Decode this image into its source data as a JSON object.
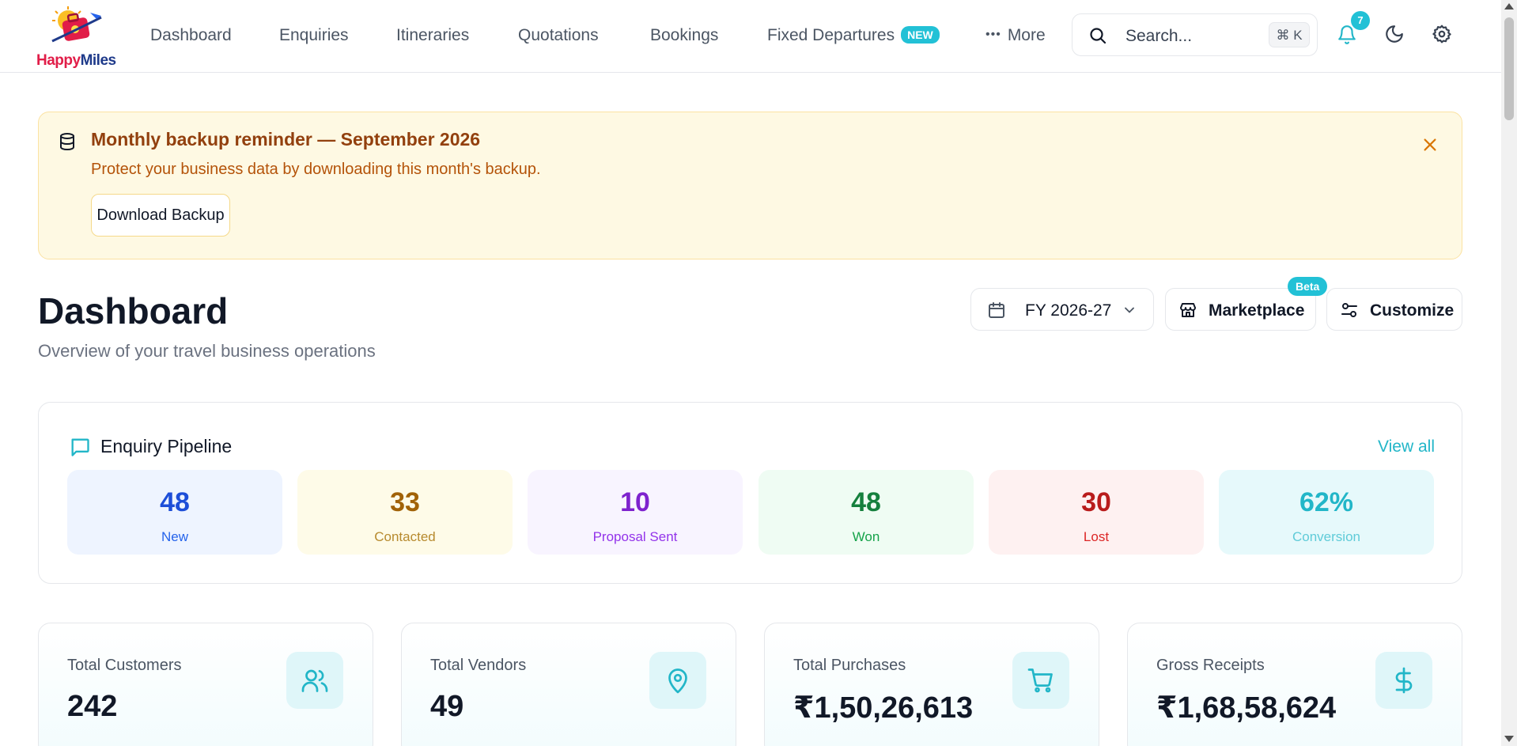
{
  "brand": {
    "logo_part1": "Happy",
    "logo_part2": "Miles"
  },
  "nav": {
    "items": [
      "Dashboard",
      "Enquiries",
      "Itineraries",
      "Quotations",
      "Bookings",
      "Fixed Departures"
    ],
    "new_badge": "NEW",
    "more": "More",
    "search_placeholder": "Search...",
    "shortcut": "⌘ K",
    "notification_count": "7"
  },
  "banner": {
    "title": "Monthly backup reminder — September 2026",
    "subtitle": "Protect your business data by downloading this month's backup.",
    "button": "Download Backup"
  },
  "header": {
    "title": "Dashboard",
    "subtitle": "Overview of your travel business operations",
    "fiscal_year": "FY 2026-27",
    "marketplace": "Marketplace",
    "beta": "Beta",
    "customize": "Customize"
  },
  "pipeline": {
    "title": "Enquiry Pipeline",
    "view_all": "View all",
    "stages": [
      {
        "value": "48",
        "label": "New",
        "bg": "#eef4ff",
        "num_color": "#1d4ed8",
        "label_color": "#2563eb"
      },
      {
        "value": "33",
        "label": "Contacted",
        "bg": "#fefbe8",
        "num_color": "#a16207",
        "label_color": "#b78a2e"
      },
      {
        "value": "10",
        "label": "Proposal Sent",
        "bg": "#f8f4ff",
        "num_color": "#7e22ce",
        "label_color": "#9333ea"
      },
      {
        "value": "48",
        "label": "Won",
        "bg": "#effcf3",
        "num_color": "#15803d",
        "label_color": "#16a34a"
      },
      {
        "value": "30",
        "label": "Lost",
        "bg": "#fef1f1",
        "num_color": "#b91c1c",
        "label_color": "#dc2626"
      },
      {
        "value": "62%",
        "label": "Conversion",
        "bg": "#e6f9fb",
        "num_color": "#22b6c8",
        "label_color": "#5fcbd8"
      }
    ]
  },
  "stats": [
    {
      "label": "Total Customers",
      "value": "242",
      "icon": "users-icon"
    },
    {
      "label": "Total Vendors",
      "value": "49",
      "icon": "map-pin-icon"
    },
    {
      "label": "Total Purchases",
      "value": "₹1,50,26,613",
      "icon": "cart-icon"
    },
    {
      "label": "Gross Receipts",
      "value": "₹1,68,58,624",
      "icon": "dollar-icon"
    }
  ],
  "colors": {
    "accent": "#22c1d6",
    "banner_bg": "#fef9e3",
    "banner_title": "#92400e"
  }
}
